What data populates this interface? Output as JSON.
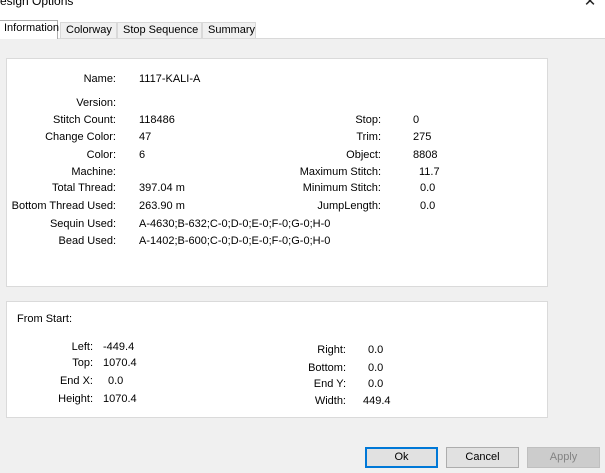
{
  "window": {
    "title": "esign Options",
    "close_glyph": "✕"
  },
  "tabs": [
    {
      "label": "Information",
      "active": true
    },
    {
      "label": "Colorway",
      "active": false
    },
    {
      "label": "Stop Sequence",
      "active": false
    },
    {
      "label": "Summary",
      "active": false
    }
  ],
  "info": {
    "left_fields": [
      {
        "label": "Name:",
        "value": "1117-KALI-A"
      },
      {
        "label": "Version:",
        "value": ""
      },
      {
        "label": "Stitch Count:",
        "value": "118486"
      },
      {
        "label": "Change Color:",
        "value": "47"
      },
      {
        "label": "Color:",
        "value": "6"
      },
      {
        "label": "Machine:",
        "value": ""
      },
      {
        "label": "Total Thread:",
        "value": "397.04 m"
      },
      {
        "label": "Bottom Thread Used:",
        "value": "263.90 m"
      },
      {
        "label": "Sequin Used:",
        "value": "A-4630;B-632;C-0;D-0;E-0;F-0;G-0;H-0"
      },
      {
        "label": "Bead Used:",
        "value": "A-1402;B-600;C-0;D-0;E-0;F-0;G-0;H-0"
      }
    ],
    "right_fields": [
      {
        "label": "Stop:",
        "value": "0"
      },
      {
        "label": "Trim:",
        "value": "275"
      },
      {
        "label": "Object:",
        "value": "8808"
      },
      {
        "label": "Maximum Stitch:",
        "value": "11.7"
      },
      {
        "label": "Minimum Stitch:",
        "value": "0.0"
      },
      {
        "label": "JumpLength:",
        "value": "0.0"
      }
    ]
  },
  "from_start": {
    "heading": "From Start:",
    "left_fields": [
      {
        "label": "Left:",
        "value": "-449.4"
      },
      {
        "label": "Top:",
        "value": "1070.4"
      },
      {
        "label": "End X:",
        "value": "0.0"
      },
      {
        "label": "Height:",
        "value": "1070.4"
      }
    ],
    "right_fields": [
      {
        "label": "Right:",
        "value": "0.0"
      },
      {
        "label": "Bottom:",
        "value": "0.0"
      },
      {
        "label": "End Y:",
        "value": "0.0"
      },
      {
        "label": "Width:",
        "value": "449.4"
      }
    ]
  },
  "buttons": {
    "ok": "Ok",
    "cancel": "Cancel",
    "apply": "Apply"
  }
}
